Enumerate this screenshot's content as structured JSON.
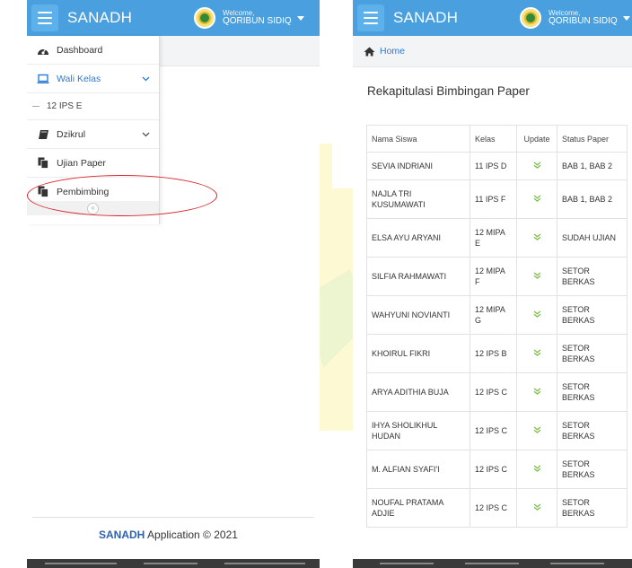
{
  "app": {
    "brand": "SANADH"
  },
  "user": {
    "welcome": "Welcome,",
    "name": "QORIBUN SIDIQ"
  },
  "sidebar": {
    "items": [
      {
        "label": "Dashboard",
        "icon": "dashboard-icon"
      },
      {
        "label": "Wali Kelas",
        "icon": "laptop-icon",
        "active": true,
        "expandable": true
      },
      {
        "label": "12 IPS E",
        "sub": true
      },
      {
        "label": "Dzikrul",
        "icon": "book-icon",
        "expandable": true
      },
      {
        "label": "Ujian Paper",
        "icon": "copy-icon"
      },
      {
        "label": "Pembimbing",
        "icon": "copy-icon"
      }
    ],
    "collapse_icon": "chevron-double-left-icon"
  },
  "footer": {
    "brand": "SANADH",
    "text": "Application © 2021"
  },
  "breadcrumb": {
    "home_label": "Home"
  },
  "page": {
    "title": "Rekapitulasi Bimbingan Paper"
  },
  "table": {
    "headers": [
      "Nama Siswa",
      "Kelas",
      "Update",
      "Status Paper"
    ],
    "rows": [
      {
        "nama": "SEVIA INDRIANI",
        "kelas": "11 IPS D",
        "status": "BAB 1, BAB 2"
      },
      {
        "nama": "NAJLA TRI KUSUMAWATI",
        "kelas": "11 IPS F",
        "status": "BAB 1, BAB 2"
      },
      {
        "nama": "ELSA AYU ARYANI",
        "kelas": "12 MIPA E",
        "status": "SUDAH UJIAN"
      },
      {
        "nama": "SILFIA RAHMAWATI",
        "kelas": "12 MIPA F",
        "status": "SETOR BERKAS"
      },
      {
        "nama": "WAHYUNI NOVIANTI",
        "kelas": "12 MIPA G",
        "status": "SETOR BERKAS"
      },
      {
        "nama": "KHOIRUL FIKRI",
        "kelas": "12 IPS B",
        "status": "SETOR BERKAS"
      },
      {
        "nama": "ARYA ADITHIA BUJA",
        "kelas": "12 IPS C",
        "status": "SETOR BERKAS"
      },
      {
        "nama": "IHYA SHOLIKHUL HUDAN",
        "kelas": "12 IPS C",
        "status": "SETOR BERKAS"
      },
      {
        "nama": "M. ALFIAN SYAFI'I",
        "kelas": "12 IPS C",
        "status": "SETOR BERKAS"
      },
      {
        "nama": "NOUFAL PRATAMA ADJIE",
        "kelas": "12 IPS C",
        "status": "SETOR BERKAS"
      }
    ],
    "update_icon": "chevron-double-down-icon"
  },
  "colors": {
    "appbar": "#4aa0df",
    "link": "#2b7bd6",
    "highlight": "#d9232c",
    "update_icon": "#7ac142"
  }
}
